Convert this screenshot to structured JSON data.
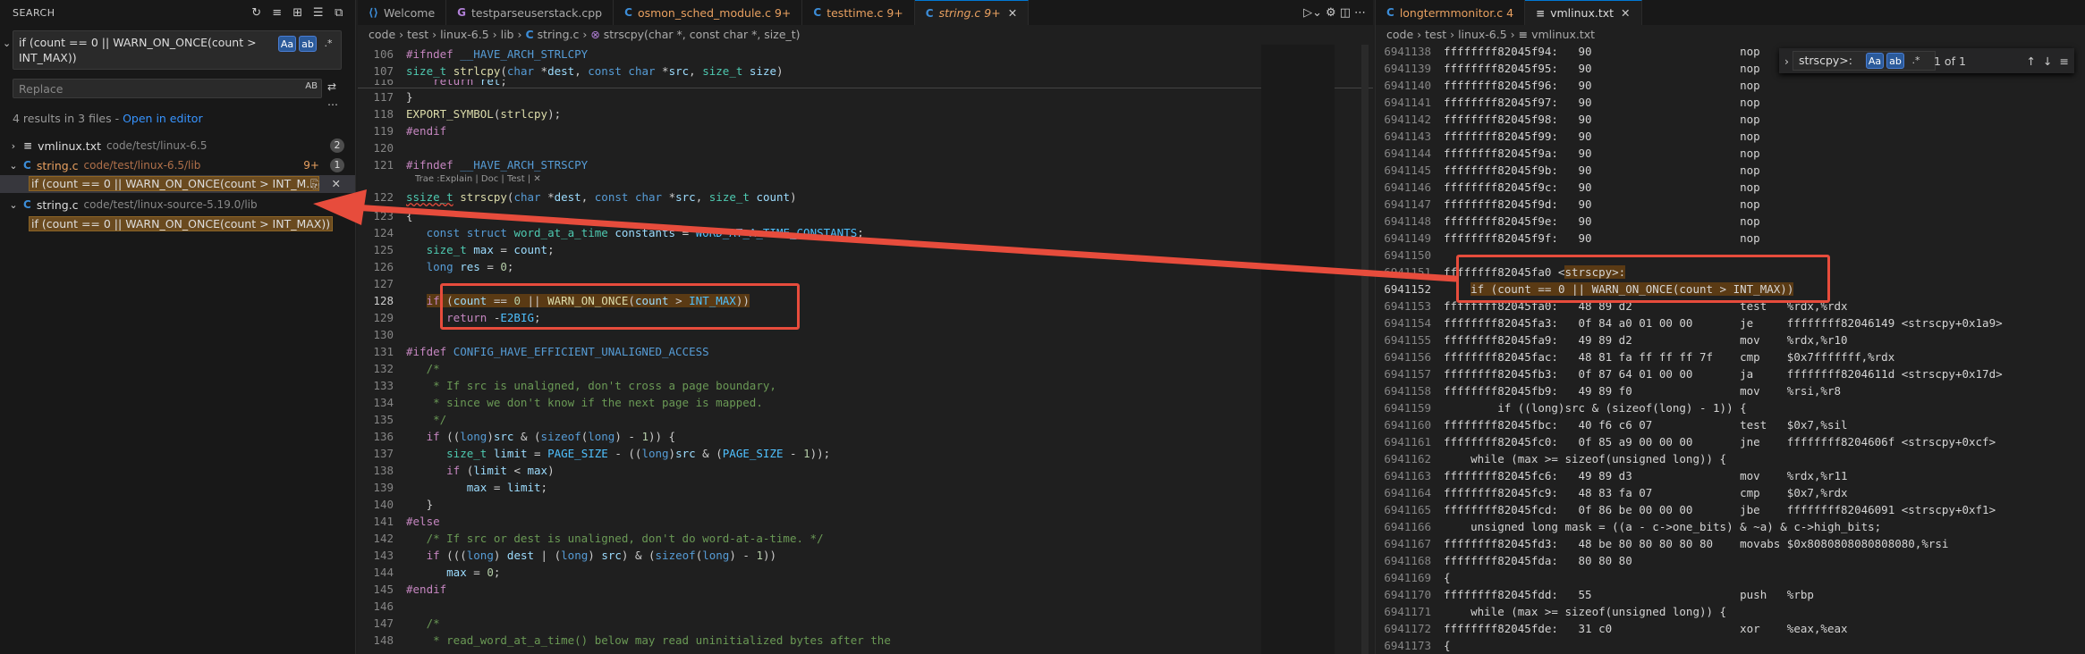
{
  "sidebar": {
    "title": "SEARCH",
    "search_value": "if (count == 0 || WARN_ON_ONCE(count > INT_MAX))",
    "search_line1": "if (count == 0 || WARN_ON_ONCE(count >",
    "search_line2": "INT_MAX))",
    "replace_placeholder": "Replace",
    "replace_opt": "AB",
    "opt_case": "Aa",
    "opt_word": "ab",
    "opt_regex": ".*",
    "results_summary": "4 results in 3 files - ",
    "open_in_editor": "Open in editor",
    "results": [
      {
        "file": "vmlinux.txt",
        "path": "code/test/linux-6.5",
        "count": "2"
      },
      {
        "file": "string.c",
        "path": "code/test/linux-6.5/lib",
        "count": "1",
        "badge": "9+",
        "match": "if (count == 0 || WARN_ON_ONCE(count > INT_M..."
      },
      {
        "file": "string.c",
        "path": "code/test/linux-source-5.19.0/lib",
        "match": "if (count == 0 || WARN_ON_ONCE(count > INT_MAX))"
      }
    ]
  },
  "editor1": {
    "tabs": [
      {
        "label": "Welcome",
        "icon": "vscode-icon"
      },
      {
        "label": "testparseuserstack.cpp",
        "icon": "cpp-icon"
      },
      {
        "label": "osmon_sched_module.c",
        "mod": "9+",
        "icon": "c-icon"
      },
      {
        "label": "testtime.c",
        "mod": "9+",
        "icon": "c-icon"
      },
      {
        "label": "string.c",
        "mod": "9+",
        "icon": "c-icon",
        "active": true
      }
    ],
    "breadcrumb": [
      "code",
      "test",
      "linux-6.5",
      "lib",
      "string.c",
      "strscpy(char *, const char *, size_t)"
    ],
    "codelens": "Trae :Explain | Doc | Test | ✕"
  },
  "editor2": {
    "tabs": [
      {
        "label": "longtermmonitor.c",
        "mod": "4",
        "icon": "c-icon"
      },
      {
        "label": "vmlinux.txt",
        "icon": "file-icon",
        "active": true
      }
    ],
    "breadcrumb": [
      "code",
      "test",
      "linux-6.5",
      "vmlinux.txt"
    ],
    "find_value": "strscpy>:",
    "find_result": "1 of 1",
    "find_case": "Aa",
    "find_word": "ab",
    "find_regex": ".*"
  },
  "colors": {
    "accent": "#0078d4",
    "highlight_box": "#e74c3c",
    "match_bg": "#6a4a1f"
  }
}
